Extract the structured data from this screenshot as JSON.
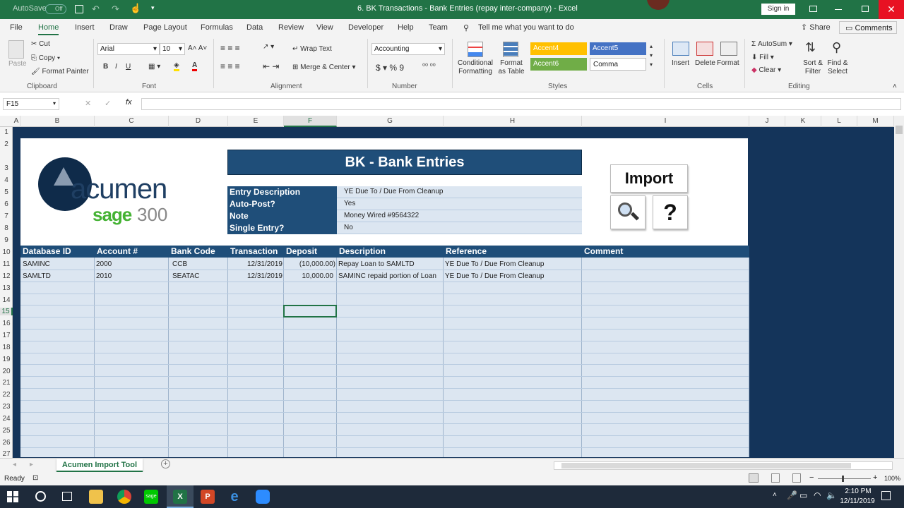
{
  "titlebar": {
    "autosave": "AutoSave",
    "autosave_state": "Off",
    "doc_title": "6. BK Transactions - Bank Entries (repay inter-company)  -  Excel",
    "sign_in": "Sign in"
  },
  "menu": [
    "File",
    "Home",
    "Insert",
    "Draw",
    "Page Layout",
    "Formulas",
    "Data",
    "Review",
    "View",
    "Developer",
    "Help",
    "Team"
  ],
  "tell_me": "Tell me what you want to do",
  "share": "Share",
  "comments": "Comments",
  "ribbon": {
    "clipboard": {
      "cut": "Cut",
      "copy": "Copy",
      "format_painter": "Format Painter",
      "paste": "Paste",
      "group": "Clipboard"
    },
    "font": {
      "name": "Arial",
      "size": "10",
      "group": "Font",
      "bold": "B",
      "italic": "I",
      "underline": "U"
    },
    "alignment": {
      "wrap": "Wrap Text",
      "merge": "Merge & Center",
      "group": "Alignment"
    },
    "number": {
      "format": "Accounting",
      "group": "Number"
    },
    "styles": {
      "cond": "Conditional Formatting",
      "table": "Format as Table",
      "accent4": "Accent4",
      "accent5": "Accent5",
      "accent6": "Accent6",
      "comma": "Comma",
      "group": "Styles"
    },
    "cells": {
      "insert": "Insert",
      "delete": "Delete",
      "format": "Format",
      "group": "Cells"
    },
    "editing": {
      "autosum": "AutoSum",
      "fill": "Fill",
      "clear": "Clear",
      "sort": "Sort & Filter",
      "find": "Find & Select",
      "group": "Editing"
    }
  },
  "name_box": "F15",
  "columns": [
    "A",
    "B",
    "C",
    "D",
    "E",
    "F",
    "G",
    "H",
    "I",
    "J",
    "K",
    "L",
    "M"
  ],
  "rows": [
    "1",
    "2",
    "3",
    "4",
    "5",
    "6",
    "7",
    "8",
    "9",
    "10",
    "11",
    "12",
    "13",
    "14",
    "15",
    "16",
    "17",
    "18",
    "19",
    "20",
    "21",
    "22",
    "23",
    "24",
    "25",
    "26",
    "27"
  ],
  "logo": {
    "brand": "acumen",
    "sub": "sage",
    "num": "300"
  },
  "form": {
    "title": "BK - Bank Entries",
    "fields": [
      {
        "label": "Entry Description",
        "value": "YE Due To / Due From Cleanup"
      },
      {
        "label": "Auto-Post?",
        "value": "Yes"
      },
      {
        "label": "Note",
        "value": "Money Wired #9564322"
      },
      {
        "label": "Single Entry?",
        "value": "No"
      }
    ],
    "import_button": "Import",
    "help_symbol": "?"
  },
  "table": {
    "headers": [
      "Database ID",
      "Account #",
      "Bank Code",
      "Transaction",
      "Deposit",
      "Description",
      "Reference",
      "Comment"
    ],
    "rows": [
      [
        "SAMINC",
        "2000",
        "CCB",
        "12/31/2019",
        "(10,000.00)",
        "Repay Loan to SAMLTD",
        "YE Due To / Due From Cleanup",
        ""
      ],
      [
        "SAMLTD",
        "2010",
        "SEATAC",
        "12/31/2019",
        "10,000.00",
        "SAMINC repaid portion of Loan",
        "YE Due To / Due From Cleanup",
        ""
      ]
    ]
  },
  "sheet_tab": "Acumen Import Tool",
  "status": {
    "ready": "Ready",
    "zoom": "100%"
  },
  "clock": {
    "time": "2:10 PM",
    "date": "12/11/2019"
  },
  "colors": {
    "excel_green": "#217346",
    "header_blue": "#1f4e79",
    "cell_blue": "#dce6f1",
    "sheet_bg": "#14345a"
  }
}
